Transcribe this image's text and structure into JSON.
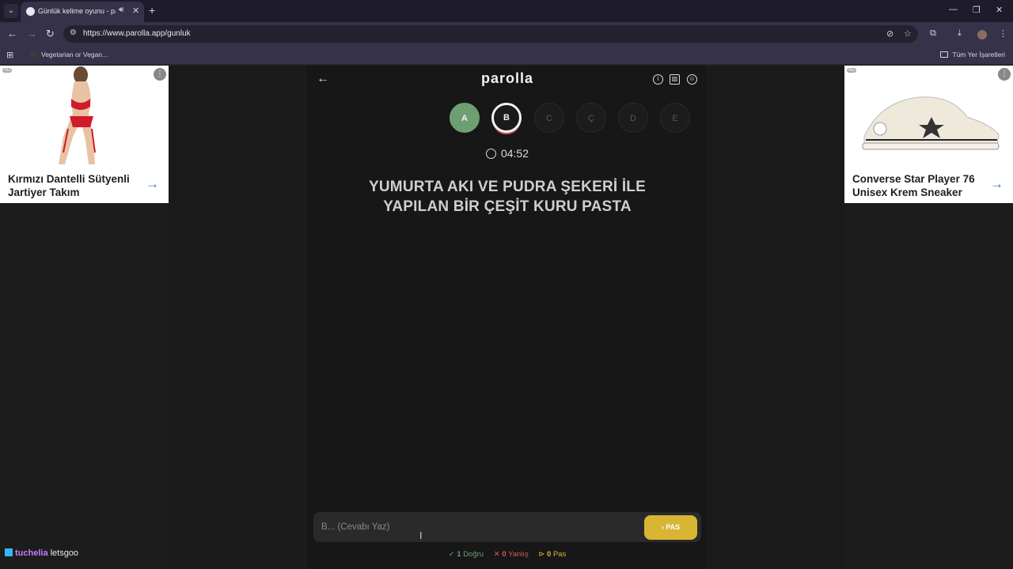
{
  "browser": {
    "tab_title": "Günlük kelime oyunu - parolla",
    "url": "https://www.parolla.app/gunluk",
    "bookmark_item": "Vegetarian or Vegan...",
    "all_bookmarks": "Tüm Yer İşaretleri"
  },
  "ads": {
    "left": {
      "badge": "AD",
      "title": "Kırmızı Dantelli Sütyenli Jartiyer Takım"
    },
    "right": {
      "badge": "AD",
      "title": "Converse Star Player 76 Unisex Krem Sneaker"
    }
  },
  "game": {
    "logo": "parolla",
    "letters": [
      {
        "label": "A",
        "state": "done"
      },
      {
        "label": "B",
        "state": "active"
      },
      {
        "label": "C",
        "state": "pending"
      },
      {
        "label": "Ç",
        "state": "pending"
      },
      {
        "label": "D",
        "state": "pending"
      },
      {
        "label": "E",
        "state": "pending"
      }
    ],
    "timer": "04:52",
    "question": "YUMURTA AKI VE PUDRA ŞEKERİ İLE YAPILAN BİR ÇEŞİT KURU PASTA",
    "answer_placeholder": "B... (Cevabı Yaz)",
    "pass_label": "PAS",
    "stats": {
      "correct_count": "1",
      "correct_label": "Doğru",
      "wrong_count": "0",
      "wrong_label": "Yanlış",
      "pass_count": "0",
      "pass_label": "Pas"
    }
  },
  "watermark": {
    "brand": "tuchelia",
    "user": "letsgoo"
  },
  "colors": {
    "done": "#6e9f73",
    "pass": "#d9b534",
    "wrong": "#d65858",
    "link": "#2a6fd6"
  }
}
